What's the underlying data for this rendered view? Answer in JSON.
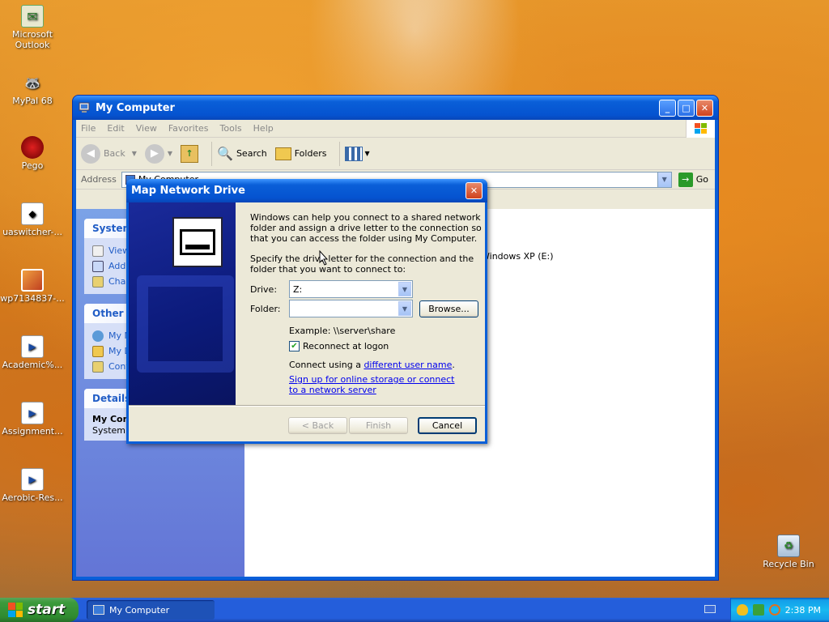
{
  "desktop": {
    "icons": [
      {
        "label": "Microsoft\nOutlook",
        "icon": "outlook-icon"
      },
      {
        "label": "MyPal 68",
        "icon": "mypal-icon"
      },
      {
        "label": "Pego",
        "icon": "pego-icon"
      },
      {
        "label": "uaswitcher-...",
        "icon": "uaswitcher-icon"
      },
      {
        "label": "wp7134837-...",
        "icon": "image-file-icon"
      },
      {
        "label": "Academic%...",
        "icon": "media-file-icon"
      },
      {
        "label": "Assignment...",
        "icon": "media-file-icon"
      },
      {
        "label": "Aerobic-Res...",
        "icon": "media-file-icon"
      },
      {
        "label": "Recycle Bin",
        "icon": "recycle-bin-icon"
      }
    ]
  },
  "window": {
    "title": "My Computer",
    "menu": [
      "File",
      "Edit",
      "View",
      "Favorites",
      "Tools",
      "Help"
    ],
    "toolbar": {
      "back": "Back",
      "search": "Search",
      "folders": "Folders"
    },
    "address_label": "Address",
    "address_value": "My Computer",
    "go_label": "Go",
    "panels": {
      "system_tasks": {
        "title": "System Tasks",
        "items": [
          "View system information",
          "Add or remove programs",
          "Change a setting"
        ]
      },
      "other_places": {
        "title": "Other Places",
        "items": [
          "My Network Places",
          "My Documents",
          "Control Panel"
        ]
      },
      "details": {
        "title": "Details",
        "name": "My Computer",
        "type": "System Folder"
      }
    },
    "drive_e_label": "Windows XP (E:)"
  },
  "dialog": {
    "title": "Map Network Drive",
    "intro": "Windows can help you connect to a shared network folder and assign a drive letter to the connection so that you can access the folder using My Computer.",
    "specify": "Specify the drive letter for the connection and the folder that you want to connect to:",
    "drive_label": "Drive:",
    "drive_value": "Z:",
    "folder_label": "Folder:",
    "folder_value": "",
    "browse_label": "Browse...",
    "example": "Example: \\\\server\\share",
    "reconnect_label": "Reconnect at logon",
    "reconnect_checked": true,
    "connect_prefix": "Connect using a ",
    "connect_link": "different user name",
    "connect_suffix": ".",
    "signup_link": "Sign up for online storage or connect to a network server",
    "back_label": "< Back",
    "finish_label": "Finish",
    "cancel_label": "Cancel"
  },
  "taskbar": {
    "start_label": "start",
    "task_label": "My Computer",
    "clock": "2:38 PM"
  },
  "colors": {
    "xp_blue": "#0a5fd8",
    "task_green": "#3c9a3c",
    "link": "#0000ee",
    "panel_title": "#215dc6"
  }
}
